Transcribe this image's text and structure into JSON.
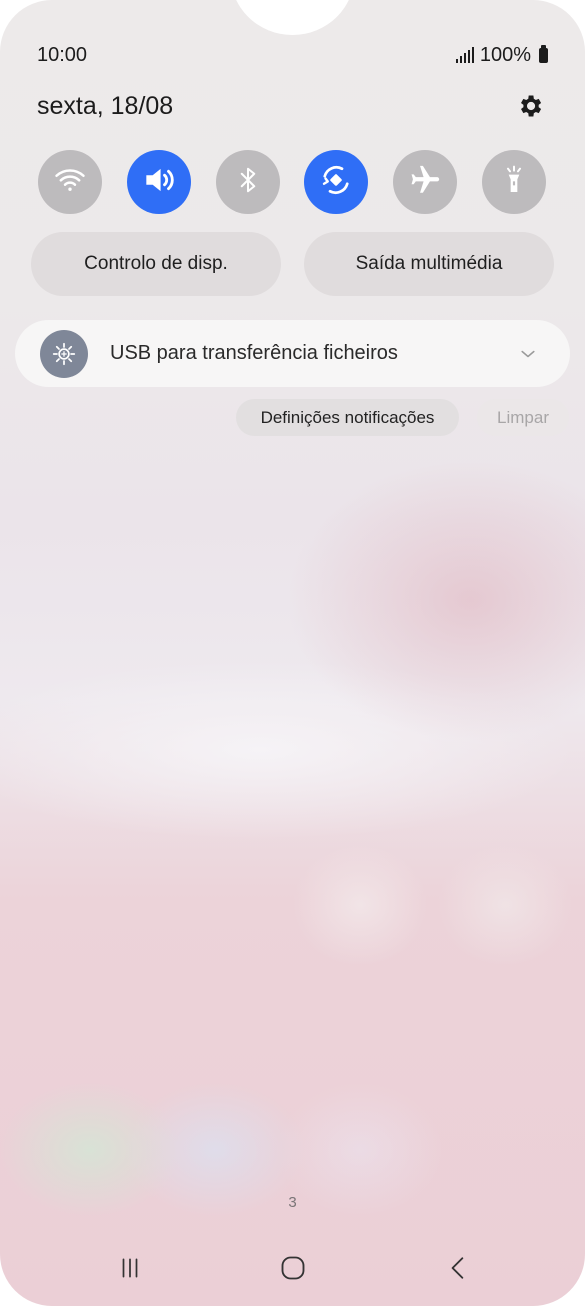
{
  "status_bar": {
    "time": "10:00",
    "battery": "100%"
  },
  "header": {
    "date": "sexta, 18/08"
  },
  "quick_settings": {
    "toggles": [
      {
        "icon": "wifi-icon",
        "state": "off"
      },
      {
        "icon": "sound-icon",
        "state": "on"
      },
      {
        "icon": "bluetooth-icon",
        "state": "off"
      },
      {
        "icon": "auto-rotate-icon",
        "state": "on"
      },
      {
        "icon": "airplane-icon",
        "state": "off"
      },
      {
        "icon": "flashlight-icon",
        "state": "off"
      }
    ],
    "device_control_label": "Controlo de disp.",
    "media_output_label": "Saída multimédia"
  },
  "notification": {
    "icon": "usb-settings-icon",
    "title": "USB para transferência ficheiros"
  },
  "actions": {
    "notification_settings_label": "Definições notificações",
    "clear_label": "Limpar"
  },
  "page_indicator": "3",
  "colors": {
    "accent": "#2f6ef6",
    "toggle_off": "#bdbbbd"
  }
}
